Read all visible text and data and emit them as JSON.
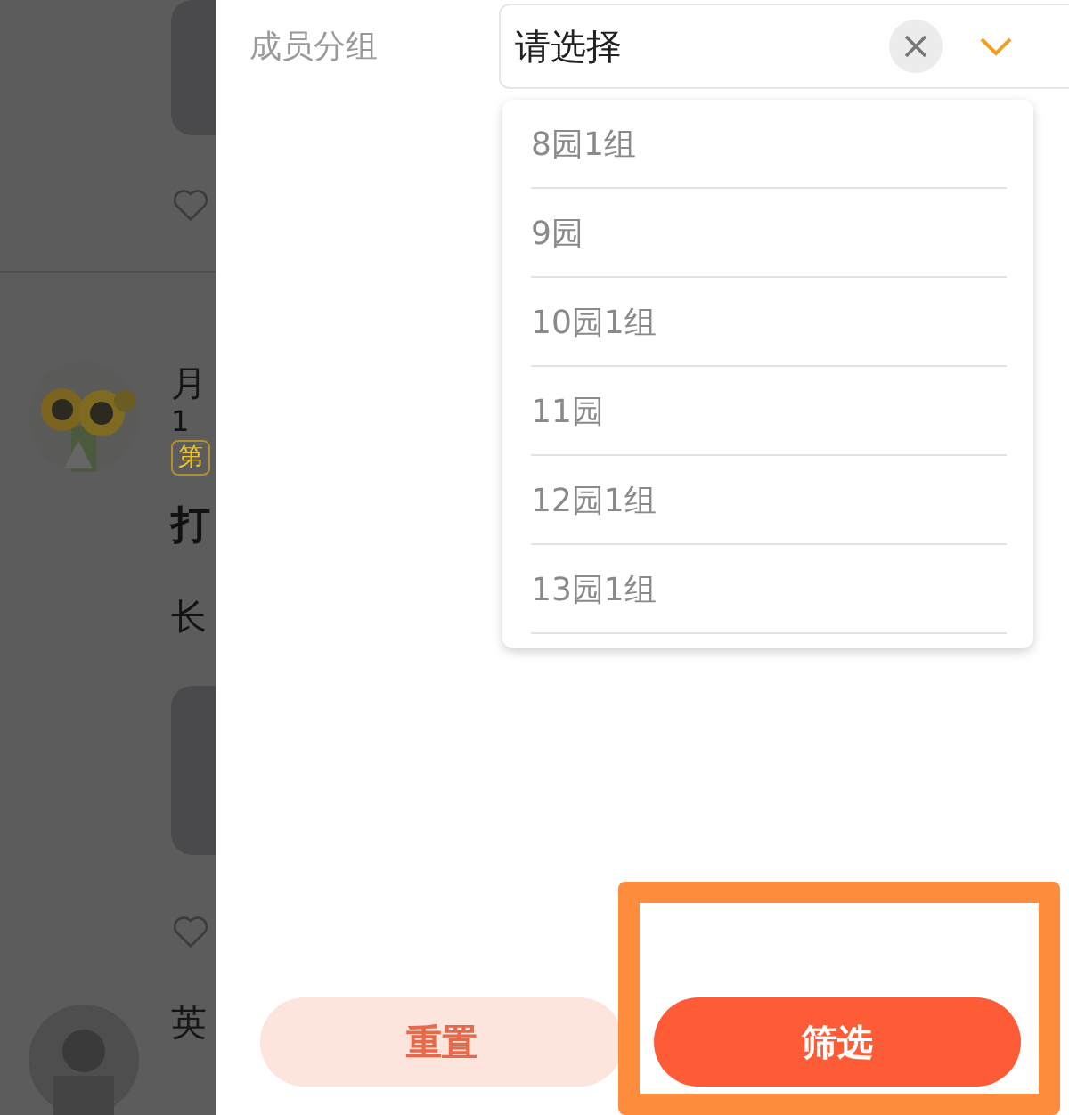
{
  "background_feed": {
    "post_1": {
      "author": "月",
      "time": "1",
      "tag": "第",
      "title": "打",
      "text": "长"
    },
    "post_2": {
      "author": "英"
    }
  },
  "filter": {
    "label": "成员分组",
    "select": {
      "placeholder": "请选择"
    },
    "options": [
      {
        "label": "8园1组"
      },
      {
        "label": "9园"
      },
      {
        "label": "10园1组"
      },
      {
        "label": "11园"
      },
      {
        "label": "12园1组"
      },
      {
        "label": "13园1组"
      }
    ]
  },
  "buttons": [
    {
      "label": "重置",
      "kind": "secondary",
      "highlighted": false
    },
    {
      "label": "筛选",
      "kind": "primary",
      "highlighted": true
    }
  ]
}
